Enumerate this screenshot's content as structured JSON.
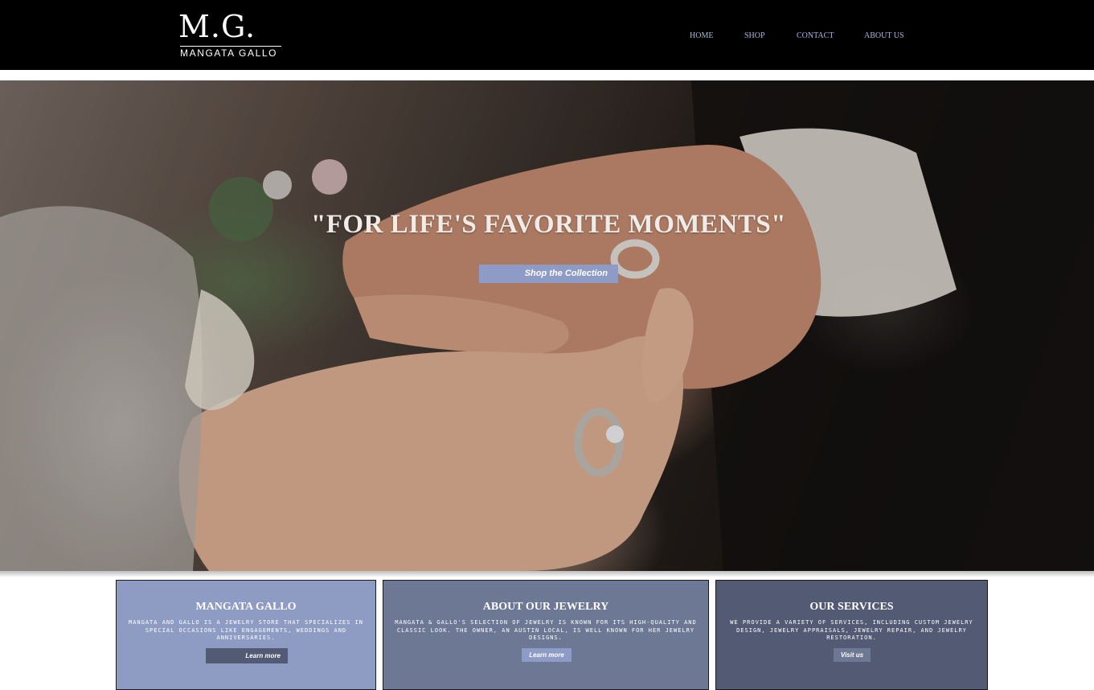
{
  "header": {
    "logo_mark": "M.G.",
    "logo_sub": "MANGATA GALLO",
    "nav": [
      "HOME",
      "SHOP",
      "CONTACT",
      "ABOUT US"
    ]
  },
  "hero": {
    "title": "\"FOR LIFE'S FAVORITE MOMENTS\"",
    "button_label": "Shop the Collection"
  },
  "cards": [
    {
      "title": "MANGATA GALLO",
      "text": "MANGATA AND GALLO IS A JEWELRY STORE THAT SPECIALIZES IN SPECIAL OCCASIONS LIKE ENGAGEMENTS, WEDDINGS AND ANNIVERSARIES.",
      "button_label": "Learn more"
    },
    {
      "title": "ABOUT OUR JEWELRY",
      "text": "MANGATA & GALLO'S SELECTION OF JEWELRY IS KNOWN FOR ITS HIGH-QUALITY AND CLASSIC LOOK. THE OWNER, AN AUSTIN LOCAL, IS WELL KNOWN FOR HER JEWELRY DESIGNS.",
      "button_label": "Learn more"
    },
    {
      "title": "OUR SERVICES",
      "text": "WE PROVIDE A VARIETY OF SERVICES, INCLUDING CUSTOM JEWELRY DESIGN, JEWELRY APPRAISALS, JEWELRY REPAIR, AND JEWELRY RESTORATION.",
      "button_label": "Visit us"
    }
  ],
  "colors": {
    "header_bg": "#000000",
    "nav_text": "#a9b7e0",
    "accent_periwinkle": "#8e9bc6",
    "card_mid": "#6d7895",
    "card_dark": "#525a74"
  },
  "icons": {
    "hero_image": "wedding-ring-hands-photo"
  }
}
